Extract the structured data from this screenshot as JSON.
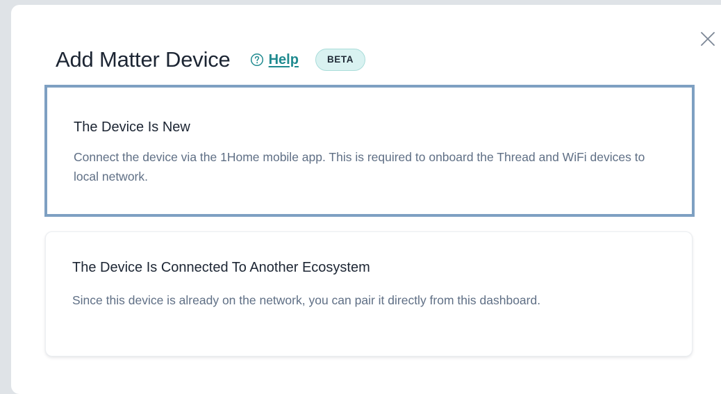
{
  "modal": {
    "title": "Add Matter Device",
    "help_label": "Help",
    "badge_label": "BETA",
    "close_icon": "close-icon",
    "help_icon": "question-circle-icon"
  },
  "options": [
    {
      "title": "The Device Is New",
      "description": "Connect the device via the 1Home mobile app. This is required to onboard the Thread and WiFi devices to local network.",
      "selected": true
    },
    {
      "title": "The Device Is Connected To Another Ecosystem",
      "description": "Since this device is already on the network, you can pair it directly from this dashboard.",
      "selected": false
    }
  ],
  "colors": {
    "accent": "#1f8a8f",
    "selected_border": "#7ea0c2",
    "badge_bg": "#d9f2f1",
    "title_text": "#1c2533",
    "body_text": "#5f6f85",
    "backdrop": "#dfe3e7"
  }
}
